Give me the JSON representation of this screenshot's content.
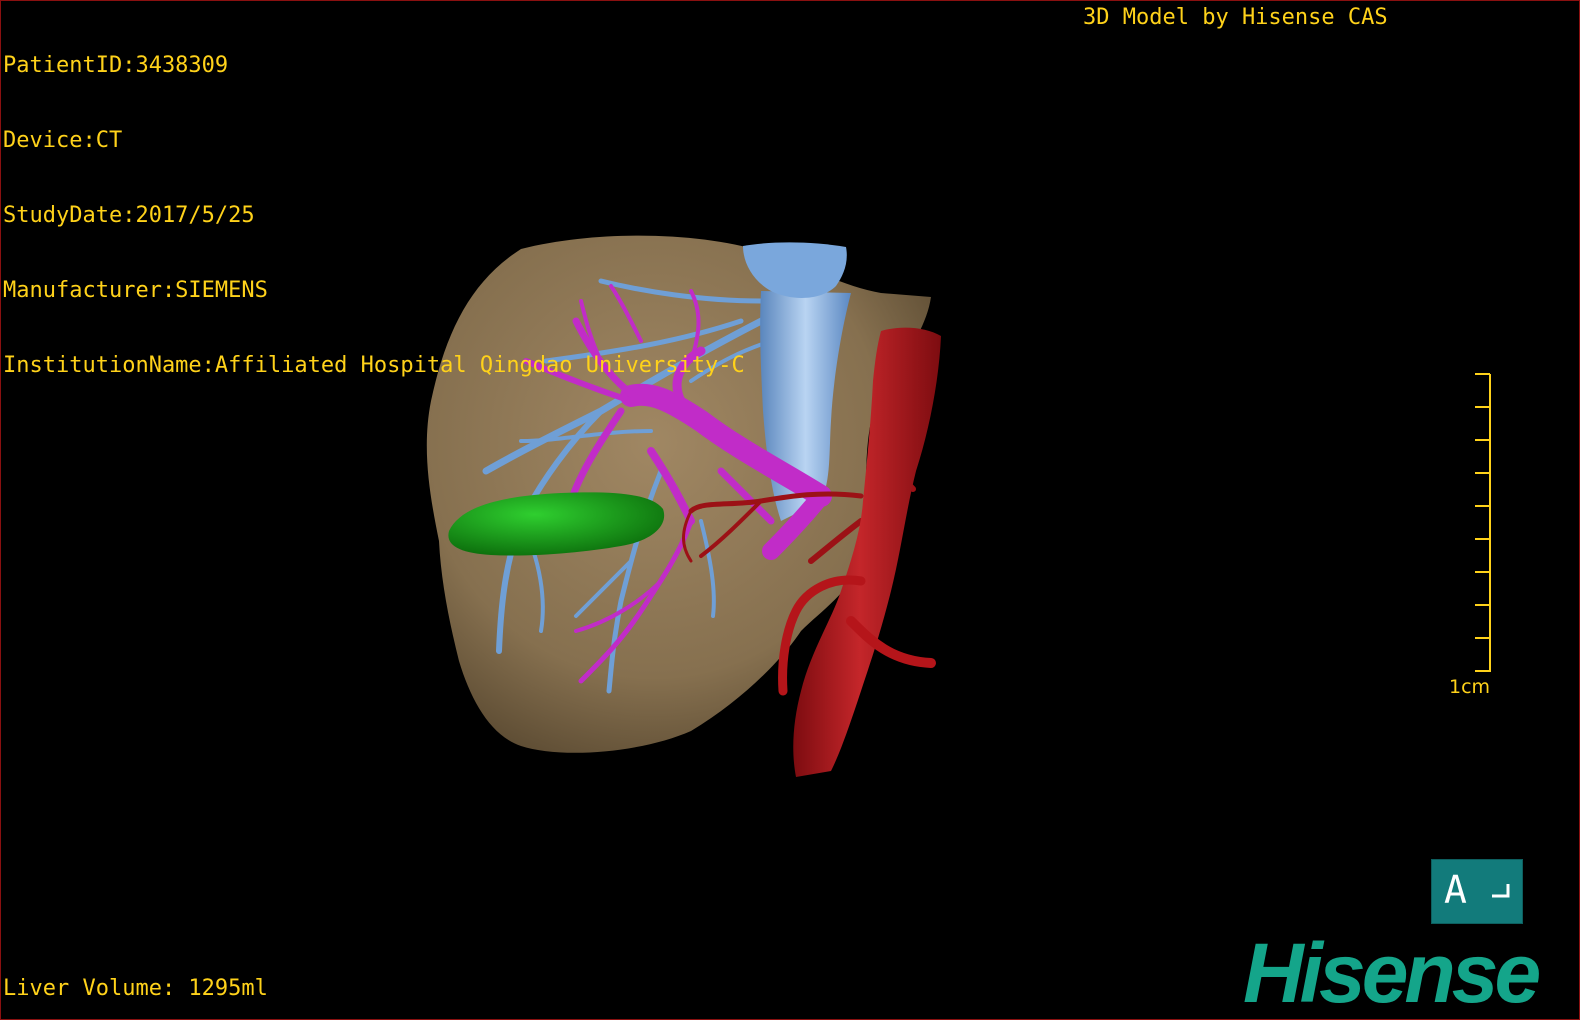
{
  "study_info": {
    "patient_id": "PatientID:3438309",
    "device": "Device:CT",
    "study_date": "StudyDate:2017/5/25",
    "manufacturer": "Manufacturer:SIEMENS",
    "institution": "InstitutionName:Affiliated Hospital Qingdao University-C"
  },
  "model_credit": "3D Model by Hisense CAS",
  "liver_volume": "Liver Volume: 1295ml",
  "scale": {
    "label": "1cm",
    "ticks": 10
  },
  "orientation": {
    "letter": "A"
  },
  "brand": {
    "name": "Hisense"
  },
  "colors": {
    "overlay_text": "#ffd21a",
    "liver": "#8c7454",
    "hepatic_vein": "#6f9fd6",
    "portal_vein": "#c12cc8",
    "artery": "#b5151a",
    "gallbladder": "#1aa01a",
    "brand": "#14a58a",
    "orientation_cube": "#127b7b"
  },
  "structures": [
    "liver",
    "hepatic-vein",
    "portal-vein",
    "hepatic-artery",
    "aorta",
    "gallbladder"
  ]
}
